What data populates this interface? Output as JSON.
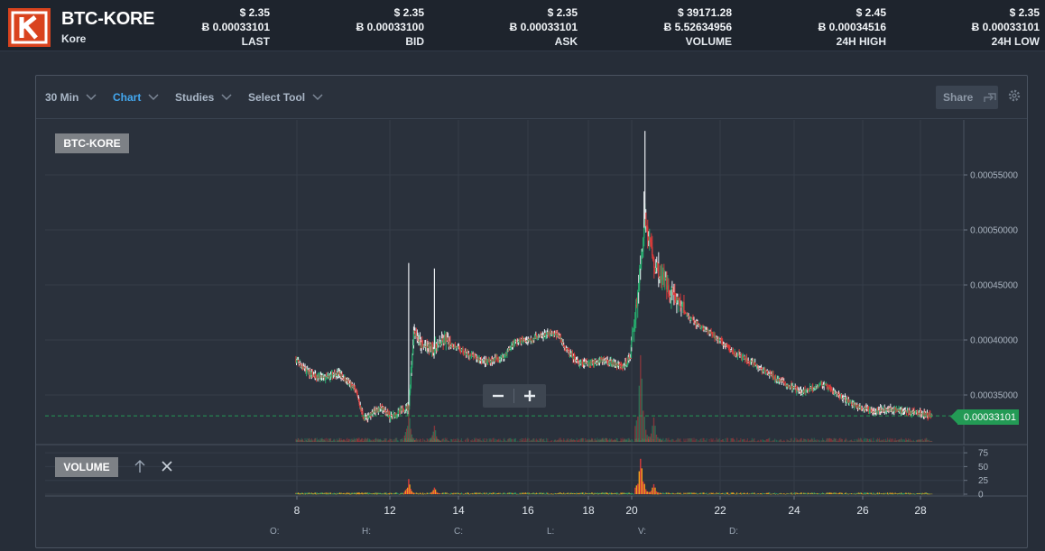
{
  "header": {
    "pair": "BTC-KORE",
    "coin_name": "Kore",
    "stats": [
      {
        "usd": "$ 2.35",
        "btc": "Ƀ 0.00033101",
        "label": "LAST"
      },
      {
        "usd": "$ 2.35",
        "btc": "Ƀ 0.00033100",
        "label": "BID"
      },
      {
        "usd": "$ 2.35",
        "btc": "Ƀ 0.00033101",
        "label": "ASK"
      },
      {
        "usd": "$ 39171.28",
        "btc": "Ƀ 5.52634956",
        "label": "VOLUME"
      },
      {
        "usd": "$ 2.45",
        "btc": "Ƀ 0.00034516",
        "label": "24H HIGH"
      },
      {
        "usd": "$ 2.35",
        "btc": "Ƀ 0.00033101",
        "label": "24H LOW"
      }
    ]
  },
  "toolbar": {
    "interval": "30 Min",
    "chart": "Chart",
    "studies": "Studies",
    "select_tool": "Select Tool",
    "share": "Share"
  },
  "chart": {
    "main_label": "BTC-KORE",
    "volume_label": "VOLUME",
    "current_price": "0.00033101",
    "ohlc_labels": [
      "O:",
      "H:",
      "C:",
      "L:",
      "V:",
      "D:"
    ],
    "colors": {
      "up": "#26a96c",
      "down": "#d93b3b",
      "wick_light": "#e8ecf0",
      "last_price": "#239a55",
      "volume_orange": "#f0a21c"
    }
  },
  "chart_data": {
    "type": "candlestick",
    "x_ticks": [
      "8",
      "12",
      "14",
      "16",
      "18",
      "20",
      "22",
      "24",
      "26",
      "28"
    ],
    "y_ticks": [
      "0.00055000",
      "0.00050000",
      "0.00045000",
      "0.00040000",
      "0.00035000"
    ],
    "ylim": [
      0.00031,
      0.0006
    ],
    "volume_ticks": [
      "75",
      "50",
      "25",
      "0"
    ],
    "volume_ylim": [
      0,
      80
    ],
    "last_price": 0.00033101,
    "price_path": [
      [
        7.96,
        0.000382
      ],
      [
        8.5,
        0.00037
      ],
      [
        9.2,
        0.000365
      ],
      [
        9.8,
        0.00037
      ],
      [
        10.5,
        0.000355
      ],
      [
        10.9,
        0.000328
      ],
      [
        11.3,
        0.000335
      ],
      [
        11.7,
        0.000338
      ],
      [
        12.0,
        0.00033
      ],
      [
        12.3,
        0.000335
      ],
      [
        12.55,
        0.00034
      ],
      [
        12.7,
        0.00041
      ],
      [
        12.9,
        0.000395
      ],
      [
        13.3,
        0.000392
      ],
      [
        13.6,
        0.0004
      ],
      [
        14.2,
        0.000388
      ],
      [
        14.8,
        0.00038
      ],
      [
        15.3,
        0.000385
      ],
      [
        15.6,
        0.000398
      ],
      [
        16.0,
        0.0004
      ],
      [
        16.6,
        0.000405
      ],
      [
        17.0,
        0.000405
      ],
      [
        17.3,
        0.00039
      ],
      [
        17.7,
        0.000378
      ],
      [
        18.2,
        0.00038
      ],
      [
        18.7,
        0.000382
      ],
      [
        19.2,
        0.000378
      ],
      [
        19.6,
        0.000375
      ],
      [
        19.95,
        0.000385
      ],
      [
        20.1,
        0.00043
      ],
      [
        20.3,
        0.00051
      ],
      [
        20.5,
        0.00047
      ],
      [
        20.8,
        0.00045
      ],
      [
        21.3,
        0.00042
      ],
      [
        21.8,
        0.000405
      ],
      [
        22.3,
        0.00039
      ],
      [
        22.9,
        0.000378
      ],
      [
        23.5,
        0.000365
      ],
      [
        24.2,
        0.000352
      ],
      [
        24.8,
        0.00036
      ],
      [
        25.3,
        0.00035
      ],
      [
        25.8,
        0.00034
      ],
      [
        26.2,
        0.000336
      ],
      [
        27.0,
        0.000337
      ],
      [
        27.8,
        0.000334
      ],
      [
        28.4,
        0.000331
      ]
    ],
    "spikes": [
      [
        12.55,
        0.00047
      ],
      [
        13.3,
        0.000465
      ],
      [
        20.3,
        0.00059
      ],
      [
        20.28,
        0.000535
      ]
    ],
    "volume_bursts": [
      [
        12.55,
        30
      ],
      [
        13.3,
        14
      ],
      [
        20.2,
        75
      ],
      [
        20.5,
        20
      ]
    ]
  }
}
